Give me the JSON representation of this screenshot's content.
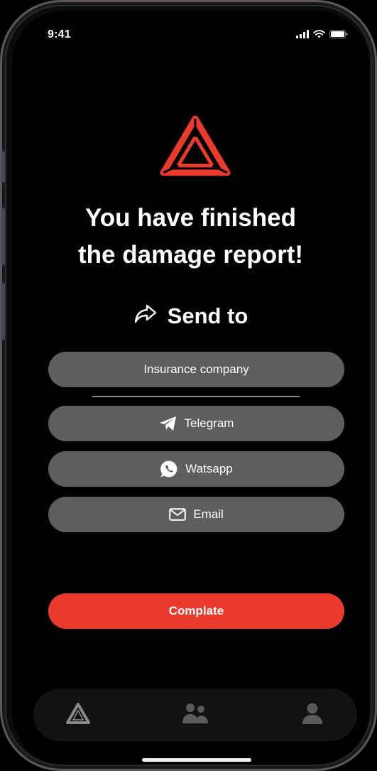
{
  "status_bar": {
    "time": "9:41",
    "signal_icon": "cellular-signal-icon",
    "wifi_icon": "wifi-icon",
    "battery_icon": "battery-icon"
  },
  "logo_icon": "warning-triangle-logo-icon",
  "headline": {
    "line1": "You have finished",
    "line2": "the damage report!"
  },
  "send_to": {
    "icon": "share-arrow-icon",
    "label": "Send to"
  },
  "options": {
    "insurance": {
      "label": "Insurance company"
    },
    "telegram": {
      "label": "Telegram",
      "icon": "telegram-icon"
    },
    "whatsapp": {
      "label": "Watsapp",
      "icon": "whatsapp-icon"
    },
    "email": {
      "label": "Email",
      "icon": "mail-icon"
    }
  },
  "primary_button": {
    "label": "Complate"
  },
  "tabs": [
    {
      "icon": "triangle-icon"
    },
    {
      "icon": "people-icon"
    },
    {
      "icon": "person-icon"
    }
  ],
  "colors": {
    "accent": "#ea3a2c",
    "button_bg": "#5e5e5e",
    "background": "#000000",
    "tabbar_bg": "#121212"
  }
}
